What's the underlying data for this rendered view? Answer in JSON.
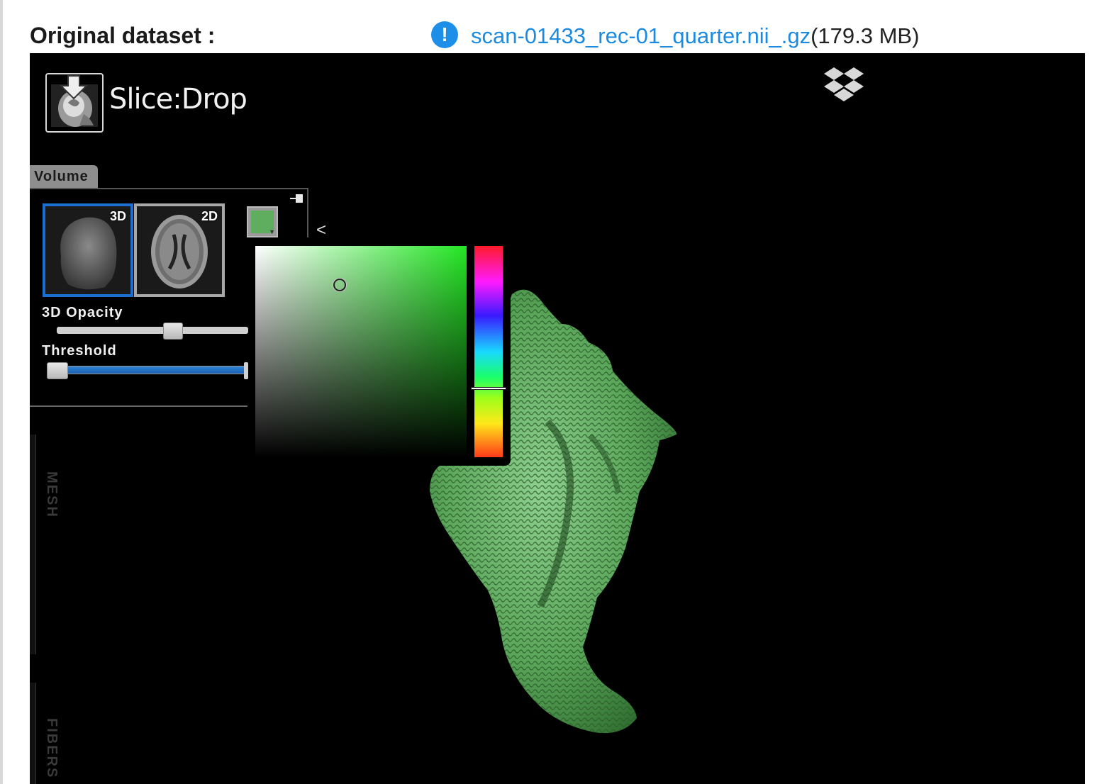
{
  "header": {
    "dataset_label": "Original dataset :",
    "file_link": "scan-01433_rec-01_quarter.nii_.gz",
    "file_size": "(179.3 MB)",
    "info_icon_glyph": "!"
  },
  "viewer": {
    "logo_text": "Slice:Drop",
    "dropbox_icon": "dropbox-icon",
    "volume_panel": {
      "tab_label": "Volume",
      "thumb_3d_label": "3D",
      "thumb_2d_label": "2D",
      "opacity_label": "3D Opacity",
      "threshold_label": "Threshold",
      "collapse_glyph": "<",
      "color_swatch": "#5fae5f",
      "opacity_value": 0.62,
      "threshold_range": [
        0.0,
        1.0
      ]
    },
    "side_tabs": [
      "MESH",
      "FIBERS"
    ],
    "color_picker": {
      "hue_color": "#24e624",
      "selected_color": "#5fae5f"
    }
  },
  "colors": {
    "link": "#1a8be0",
    "info": "#1e8fe8",
    "selected_thumb_border": "#1a6fd0",
    "threshold_track": "#2f84d6"
  }
}
